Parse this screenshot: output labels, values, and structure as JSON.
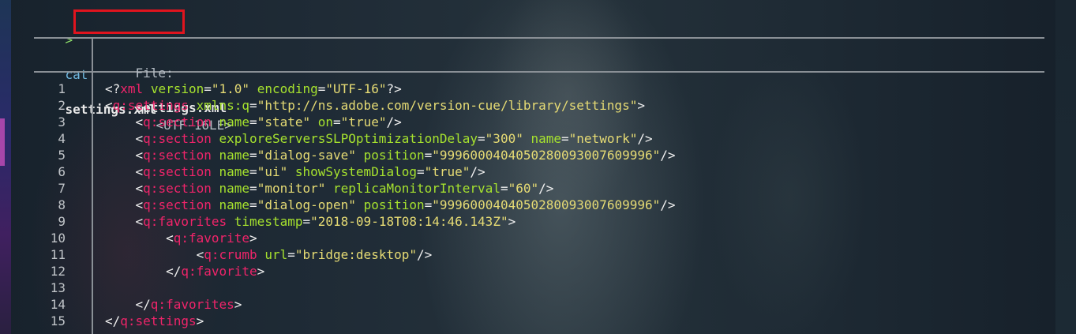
{
  "colors": {
    "tag": "#f0246a",
    "attr": "#a6e22e",
    "string": "#e6db74",
    "punct": "#f0f0f0",
    "prompt": "#8ee06a",
    "command": "#6fb8e0",
    "highlight_box": "#e0141e",
    "rule": "#8a9096"
  },
  "terminal": {
    "prompt_symbol": ">",
    "command": "cat",
    "argument": "settings.xml"
  },
  "file_header": {
    "label": "File:",
    "filename": "settings.xml",
    "encoding": "<UTF-16LE>"
  },
  "lines": [
    {
      "n": "1",
      "indent": 0,
      "tokens": [
        {
          "t": "punct",
          "v": "<?"
        },
        {
          "t": "tag",
          "v": "xml"
        },
        {
          "t": "punct",
          "v": " "
        },
        {
          "t": "attr",
          "v": "version"
        },
        {
          "t": "punct",
          "v": "="
        },
        {
          "t": "str",
          "v": "\"1.0\""
        },
        {
          "t": "punct",
          "v": " "
        },
        {
          "t": "attr",
          "v": "encoding"
        },
        {
          "t": "punct",
          "v": "="
        },
        {
          "t": "str",
          "v": "\"UTF-16\""
        },
        {
          "t": "punct",
          "v": "?>"
        }
      ]
    },
    {
      "n": "2",
      "indent": 0,
      "tokens": [
        {
          "t": "punct",
          "v": "<"
        },
        {
          "t": "tag",
          "v": "q:settings"
        },
        {
          "t": "punct",
          "v": " "
        },
        {
          "t": "attr",
          "v": "xmlns:q"
        },
        {
          "t": "punct",
          "v": "="
        },
        {
          "t": "str",
          "v": "\"http://ns.adobe.com/version-cue/library/settings\""
        },
        {
          "t": "punct",
          "v": ">"
        }
      ]
    },
    {
      "n": "3",
      "indent": 1,
      "tokens": [
        {
          "t": "punct",
          "v": "<"
        },
        {
          "t": "tag",
          "v": "q:section"
        },
        {
          "t": "punct",
          "v": " "
        },
        {
          "t": "attr",
          "v": "name"
        },
        {
          "t": "punct",
          "v": "="
        },
        {
          "t": "str",
          "v": "\"state\""
        },
        {
          "t": "punct",
          "v": " "
        },
        {
          "t": "attr",
          "v": "on"
        },
        {
          "t": "punct",
          "v": "="
        },
        {
          "t": "str",
          "v": "\"true\""
        },
        {
          "t": "punct",
          "v": "/>"
        }
      ]
    },
    {
      "n": "4",
      "indent": 1,
      "tokens": [
        {
          "t": "punct",
          "v": "<"
        },
        {
          "t": "tag",
          "v": "q:section"
        },
        {
          "t": "punct",
          "v": " "
        },
        {
          "t": "attr",
          "v": "exploreServersSLPOptimizationDelay"
        },
        {
          "t": "punct",
          "v": "="
        },
        {
          "t": "str",
          "v": "\"300\""
        },
        {
          "t": "punct",
          "v": " "
        },
        {
          "t": "attr",
          "v": "name"
        },
        {
          "t": "punct",
          "v": "="
        },
        {
          "t": "str",
          "v": "\"network\""
        },
        {
          "t": "punct",
          "v": "/>"
        }
      ]
    },
    {
      "n": "5",
      "indent": 1,
      "tokens": [
        {
          "t": "punct",
          "v": "<"
        },
        {
          "t": "tag",
          "v": "q:section"
        },
        {
          "t": "punct",
          "v": " "
        },
        {
          "t": "attr",
          "v": "name"
        },
        {
          "t": "punct",
          "v": "="
        },
        {
          "t": "str",
          "v": "\"dialog-save\""
        },
        {
          "t": "punct",
          "v": " "
        },
        {
          "t": "attr",
          "v": "position"
        },
        {
          "t": "punct",
          "v": "="
        },
        {
          "t": "str",
          "v": "\"9996000404050280093007609996\""
        },
        {
          "t": "punct",
          "v": "/>"
        }
      ]
    },
    {
      "n": "6",
      "indent": 1,
      "tokens": [
        {
          "t": "punct",
          "v": "<"
        },
        {
          "t": "tag",
          "v": "q:section"
        },
        {
          "t": "punct",
          "v": " "
        },
        {
          "t": "attr",
          "v": "name"
        },
        {
          "t": "punct",
          "v": "="
        },
        {
          "t": "str",
          "v": "\"ui\""
        },
        {
          "t": "punct",
          "v": " "
        },
        {
          "t": "attr",
          "v": "showSystemDialog"
        },
        {
          "t": "punct",
          "v": "="
        },
        {
          "t": "str",
          "v": "\"true\""
        },
        {
          "t": "punct",
          "v": "/>"
        }
      ]
    },
    {
      "n": "7",
      "indent": 1,
      "tokens": [
        {
          "t": "punct",
          "v": "<"
        },
        {
          "t": "tag",
          "v": "q:section"
        },
        {
          "t": "punct",
          "v": " "
        },
        {
          "t": "attr",
          "v": "name"
        },
        {
          "t": "punct",
          "v": "="
        },
        {
          "t": "str",
          "v": "\"monitor\""
        },
        {
          "t": "punct",
          "v": " "
        },
        {
          "t": "attr",
          "v": "replicaMonitorInterval"
        },
        {
          "t": "punct",
          "v": "="
        },
        {
          "t": "str",
          "v": "\"60\""
        },
        {
          "t": "punct",
          "v": "/>"
        }
      ]
    },
    {
      "n": "8",
      "indent": 1,
      "tokens": [
        {
          "t": "punct",
          "v": "<"
        },
        {
          "t": "tag",
          "v": "q:section"
        },
        {
          "t": "punct",
          "v": " "
        },
        {
          "t": "attr",
          "v": "name"
        },
        {
          "t": "punct",
          "v": "="
        },
        {
          "t": "str",
          "v": "\"dialog-open\""
        },
        {
          "t": "punct",
          "v": " "
        },
        {
          "t": "attr",
          "v": "position"
        },
        {
          "t": "punct",
          "v": "="
        },
        {
          "t": "str",
          "v": "\"9996000404050280093007609996\""
        },
        {
          "t": "punct",
          "v": "/>"
        }
      ]
    },
    {
      "n": "9",
      "indent": 1,
      "tokens": [
        {
          "t": "punct",
          "v": "<"
        },
        {
          "t": "tag",
          "v": "q:favorites"
        },
        {
          "t": "punct",
          "v": " "
        },
        {
          "t": "attr",
          "v": "timestamp"
        },
        {
          "t": "punct",
          "v": "="
        },
        {
          "t": "str",
          "v": "\"2018-09-18T08:14:46.143Z\""
        },
        {
          "t": "punct",
          "v": ">"
        }
      ]
    },
    {
      "n": "10",
      "indent": 2,
      "tokens": [
        {
          "t": "punct",
          "v": "<"
        },
        {
          "t": "tag",
          "v": "q:favorite"
        },
        {
          "t": "punct",
          "v": ">"
        }
      ]
    },
    {
      "n": "11",
      "indent": 3,
      "tokens": [
        {
          "t": "punct",
          "v": "<"
        },
        {
          "t": "tag",
          "v": "q:crumb"
        },
        {
          "t": "punct",
          "v": " "
        },
        {
          "t": "attr",
          "v": "url"
        },
        {
          "t": "punct",
          "v": "="
        },
        {
          "t": "str",
          "v": "\"bridge:desktop\""
        },
        {
          "t": "punct",
          "v": "/>"
        }
      ]
    },
    {
      "n": "12",
      "indent": 2,
      "tokens": [
        {
          "t": "punct",
          "v": "</"
        },
        {
          "t": "tag",
          "v": "q:favorite"
        },
        {
          "t": "punct",
          "v": ">"
        }
      ]
    },
    {
      "n": "13",
      "indent": 0,
      "tokens": []
    },
    {
      "n": "14",
      "indent": 1,
      "tokens": [
        {
          "t": "punct",
          "v": "</"
        },
        {
          "t": "tag",
          "v": "q:favorites"
        },
        {
          "t": "punct",
          "v": ">"
        }
      ]
    },
    {
      "n": "15",
      "indent": 0,
      "tokens": [
        {
          "t": "punct",
          "v": "</"
        },
        {
          "t": "tag",
          "v": "q:settings"
        },
        {
          "t": "punct",
          "v": ">"
        }
      ]
    }
  ]
}
